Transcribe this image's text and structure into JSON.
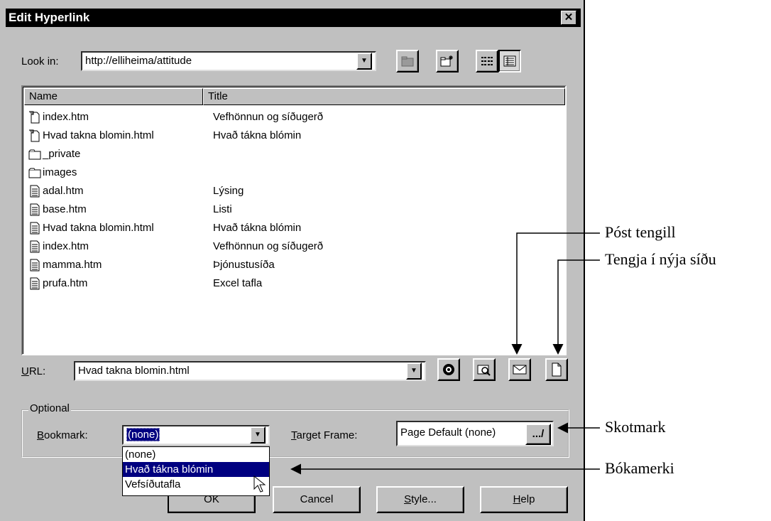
{
  "dialog": {
    "title": "Edit Hyperlink",
    "close_glyph": "✕"
  },
  "look_in": {
    "label": "Look in:",
    "value": "http://elliheima/attitude"
  },
  "file_list": {
    "columns": [
      "Name",
      "Title"
    ],
    "rows": [
      {
        "icon": "web-page-icon",
        "name": "index.htm",
        "title": "Vefhönnun og síðugerð"
      },
      {
        "icon": "web-page-icon",
        "name": "Hvad takna blomin.html",
        "title": "Hvað tákna blómin"
      },
      {
        "icon": "folder-icon",
        "name": "_private",
        "title": ""
      },
      {
        "icon": "folder-icon",
        "name": "images",
        "title": ""
      },
      {
        "icon": "document-icon",
        "name": "adal.htm",
        "title": "Lýsing"
      },
      {
        "icon": "document-icon",
        "name": "base.htm",
        "title": "Listi"
      },
      {
        "icon": "document-icon",
        "name": "Hvad takna blomin.html",
        "title": "Hvað tákna blómin"
      },
      {
        "icon": "document-icon",
        "name": "index.htm",
        "title": "Vefhönnun og síðugerð"
      },
      {
        "icon": "document-icon",
        "name": "mamma.htm",
        "title": "Þjónustusíða"
      },
      {
        "icon": "document-icon",
        "name": "prufa.htm",
        "title": "Excel tafla"
      }
    ]
  },
  "url": {
    "label_first": "U",
    "label_rest": "RL:",
    "value": "Hvad takna blomin.html"
  },
  "optional": {
    "group_label": "Optional",
    "bookmark_label_first": "B",
    "bookmark_label_rest": "ookmark:",
    "bookmark_value": "(none)",
    "target_label_first": "T",
    "target_label_rest": "arget Frame:",
    "target_value": "Page Default (none)",
    "target_button": "...",
    "bookmark_options": [
      "(none)",
      "Hvað tákna blómin",
      "Vefsíðutafla"
    ]
  },
  "buttons": {
    "ok": "OK",
    "cancel": "Cancel",
    "style_first": "S",
    "style_rest": "tyle...",
    "help_first": "H",
    "help_rest": "elp"
  },
  "annotations": {
    "post_link": "Póst tengill",
    "new_page": "Tengja í nýja síðu",
    "target": "Skotmark",
    "bookmark": "Bókamerki"
  }
}
